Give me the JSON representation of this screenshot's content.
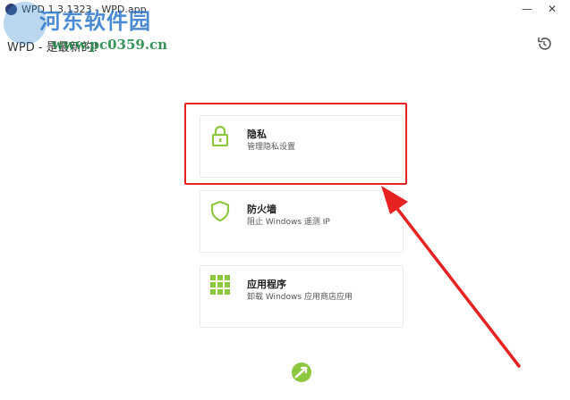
{
  "window": {
    "title": "WPD 1.3.1323 - WPD.app",
    "minimize_glyph": "—",
    "close_glyph": "✕"
  },
  "header": {
    "subtitle": "WPD - 是最新的！"
  },
  "watermark": {
    "site_name": "河东软件园",
    "url": "www.pc0359.cn"
  },
  "cards": [
    {
      "title": "隐私",
      "description": "管理隐私设置",
      "icon": "lock-icon"
    },
    {
      "title": "防火墙",
      "description": "阻止 Windows 遥测 IP",
      "icon": "shield-icon"
    },
    {
      "title": "应用程序",
      "description": "卸载 Windows 应用商店应用",
      "icon": "app-grid-icon"
    }
  ],
  "colors": {
    "accent_green": "#8dc63f",
    "annotation_red": "#e62222"
  }
}
